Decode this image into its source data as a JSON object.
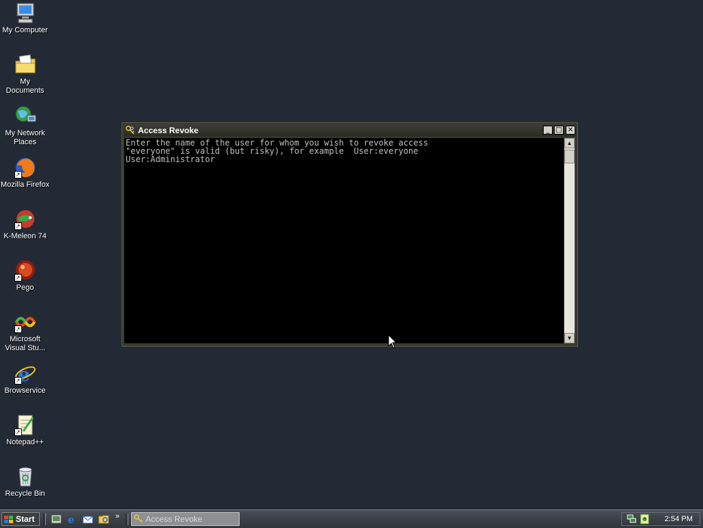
{
  "desktop": {
    "icons": [
      {
        "label": "My Computer",
        "icon": "my-computer-icon"
      },
      {
        "label": "My Documents",
        "icon": "my-documents-icon"
      },
      {
        "label": "My Network\nPlaces",
        "icon": "my-network-places-icon"
      },
      {
        "label": "Mozilla Firefox",
        "icon": "firefox-icon"
      },
      {
        "label": "K-Meleon 74",
        "icon": "k-meleon-icon"
      },
      {
        "label": "Pego",
        "icon": "pego-icon"
      },
      {
        "label": "Microsoft\nVisual Stu...",
        "icon": "visual-studio-icon"
      },
      {
        "label": "Browservice",
        "icon": "internet-explorer-icon"
      },
      {
        "label": "Notepad++",
        "icon": "notepad-plus-plus-icon"
      },
      {
        "label": "Recycle Bin",
        "icon": "recycle-bin-icon"
      }
    ]
  },
  "window": {
    "title": "Access Revoke",
    "icon": "keys-icon",
    "console_lines": [
      "Enter the name of the user for whom you wish to revoke access",
      "\"everyone\" is valid (but risky), for example  User:everyone",
      "User:Administrator"
    ],
    "buttons": {
      "minimize": "_",
      "maximize": "□",
      "close": "✕"
    }
  },
  "taskbar": {
    "start_label": "Start",
    "chevron": "»",
    "task_label": "Access Revoke",
    "clock": "2:54 PM"
  },
  "colors": {
    "desktop_bg": "#232a35",
    "console_bg": "#000000",
    "console_text": "#c0c0c0"
  }
}
